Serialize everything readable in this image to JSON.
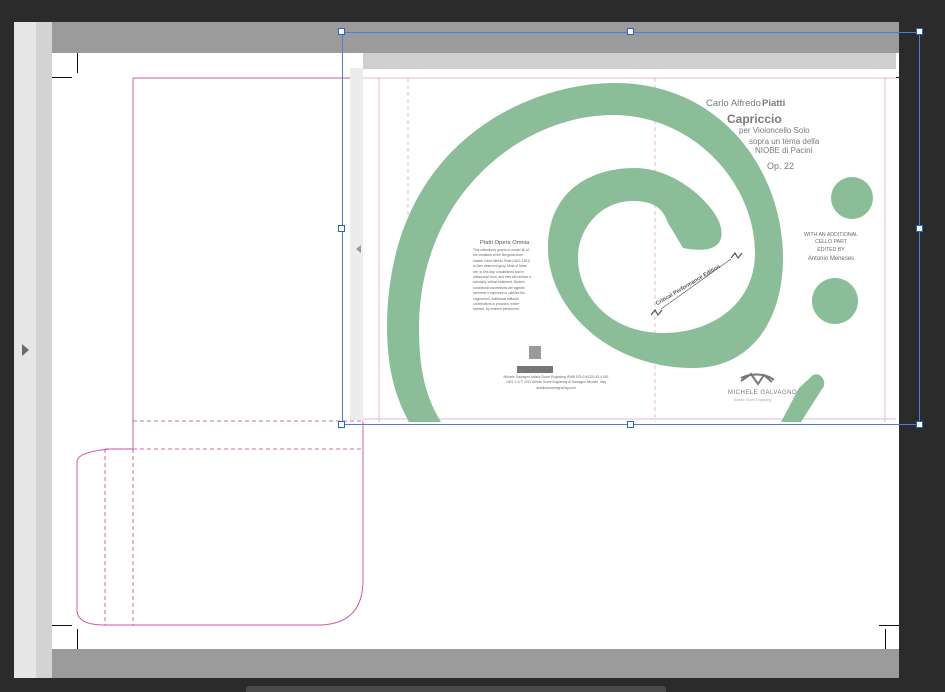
{
  "cover": {
    "composer_first": "Carlo Alfredo",
    "composer_last": "Piatti",
    "title": "Capriccio",
    "subtitle_1": "per Violoncello Solo",
    "subtitle_2": "sopra un tema della",
    "subtitle_3": "NIOBE di Pacini",
    "opus": "Op. 22",
    "credit_1": "WITH AN ADDITIONAL",
    "credit_2": "CELLO PART",
    "credit_3": "EDITED BY",
    "credit_4": "Antonio Meneses",
    "edition_label": "Critical Performance Edition",
    "series_title": "Piatti Opera Omnia",
    "blurb": "This collection's goal is to render all of the creations of the Bergamo-born master Carlo Alfredo Piatti (1822-1901) to their deserved glory. Most of these are, to this day, unpublished and in manuscript form, and they will receive a scholarly, critical treatment. Modern conditional conventions are applied wherever it improves or clarifies the original text. Additional editorial contributions is provided, where needed, by eminent performers.",
    "isbn_block": "Michele Galvagno Artistic Score Engraving ISMN 979-0-90320-43-4 MG 1001 ℗ & © 2021 Artistic Score Engraving di Galvagno Michele, Italy artisticscoreengraving.com",
    "publisher": "MICHELE GALVAGNO",
    "publisher_tagline": "Artistic Score Engraving"
  },
  "colors": {
    "accent_green": "#8bbd98",
    "dieline_magenta": "#cc5aa8",
    "selection_blue": "#4a7fd6"
  }
}
